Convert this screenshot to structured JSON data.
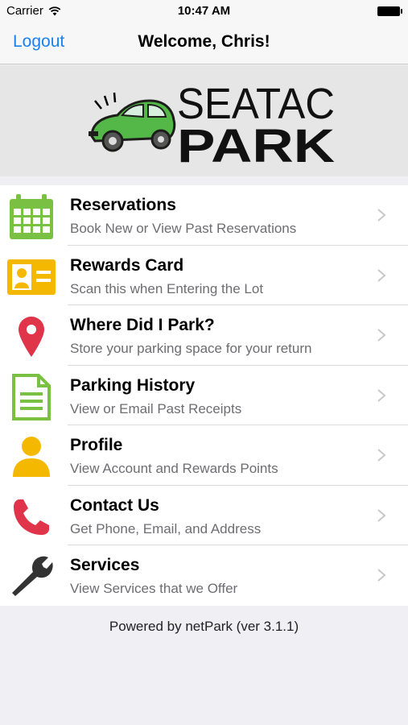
{
  "status_bar": {
    "carrier": "Carrier",
    "time": "10:47 AM"
  },
  "nav": {
    "logout_label": "Logout",
    "title": "Welcome, Chris!"
  },
  "logo": {
    "line1": "SEATAC",
    "line2": "PARK"
  },
  "menu": {
    "items": [
      {
        "label": "Reservations",
        "sub": "Book New or View Past Reservations",
        "icon": "calendar-icon",
        "color": "#7ac143"
      },
      {
        "label": "Rewards Card",
        "sub": "Scan this when Entering the Lot",
        "icon": "id-card-icon",
        "color": "#f5b800"
      },
      {
        "label": "Where Did I Park?",
        "sub": "Store your parking space for your return",
        "icon": "map-pin-icon",
        "color": "#e0344a"
      },
      {
        "label": "Parking History",
        "sub": "View or Email Past Receipts",
        "icon": "document-icon",
        "color": "#7ac143"
      },
      {
        "label": "Profile",
        "sub": "View Account and Rewards Points",
        "icon": "person-icon",
        "color": "#f5b800"
      },
      {
        "label": "Contact Us",
        "sub": "Get Phone, Email, and Address",
        "icon": "phone-icon",
        "color": "#e0344a"
      },
      {
        "label": "Services",
        "sub": "View Services that we Offer",
        "icon": "wrench-icon",
        "color": "#333333"
      }
    ]
  },
  "footer": {
    "text": "Powered by netPark (ver 3.1.1)"
  },
  "colors": {
    "accent": "#1a80f0",
    "background": "#efeff4"
  }
}
